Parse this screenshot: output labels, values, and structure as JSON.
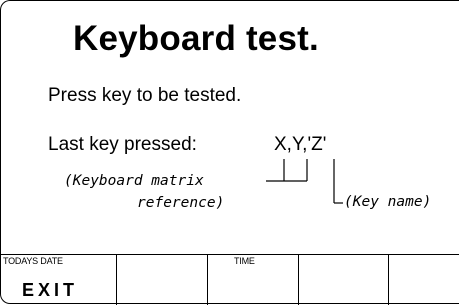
{
  "screen": {
    "title": "Keyboard test.",
    "prompt": "Press key to be tested.",
    "last_key_label": "Last key pressed:",
    "last_key_value": "X,Y,'Z'",
    "annotation_matrix_line1": "(Keyboard matrix",
    "annotation_matrix_line2": "reference)",
    "annotation_key_name": "(Key name)"
  },
  "softkeys": {
    "todays_date_label": "TODAYS DATE",
    "time_label": "TIME",
    "exit_label": "EXIT"
  }
}
